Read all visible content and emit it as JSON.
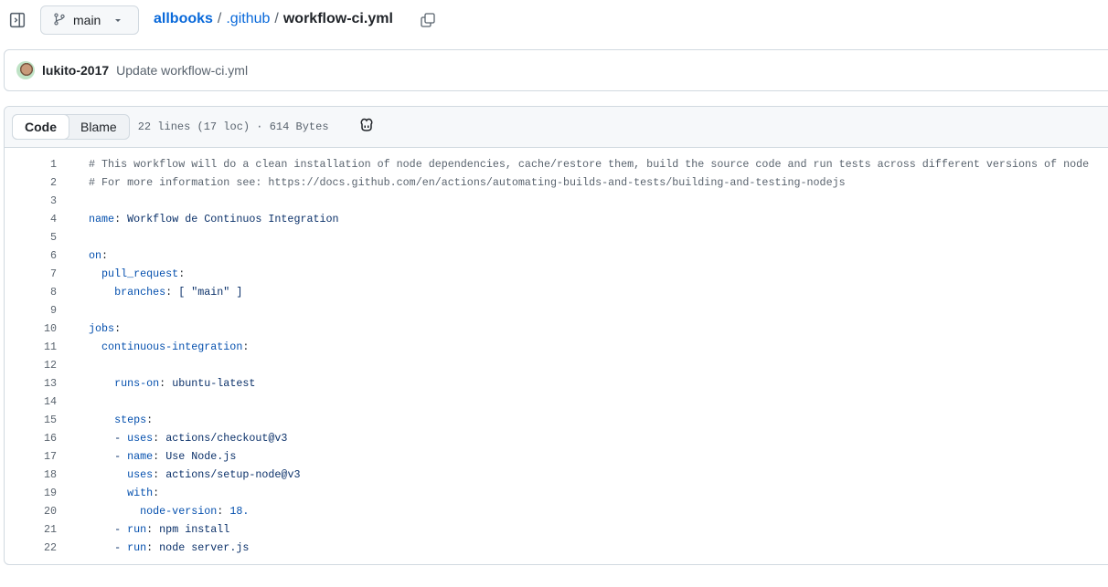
{
  "header": {
    "branch": "main",
    "repo": "allbooks",
    "folder": ".github",
    "file": "workflow-ci.yml",
    "sep": "/"
  },
  "commit": {
    "author": "lukito-2017",
    "message": "Update workflow-ci.yml"
  },
  "toolbar": {
    "code_tab": "Code",
    "blame_tab": "Blame",
    "meta": "22 lines (17 loc) · 614 Bytes"
  },
  "colors": {
    "link": "#0969da",
    "key": "#0550ae",
    "string": "#0a3069",
    "comment": "#59636e"
  },
  "lines": [
    [
      [
        "c",
        "# This workflow will do a clean installation of node dependencies, cache/restore them, build the source code and run tests across different versions of node"
      ]
    ],
    [
      [
        "c",
        "# For more information see: https://docs.github.com/en/actions/automating-builds-and-tests/building-and-testing-nodejs"
      ]
    ],
    [],
    [
      [
        "k",
        "name"
      ],
      [
        "p",
        ": "
      ],
      [
        "v",
        "Workflow de Continuos Integration"
      ]
    ],
    [],
    [
      [
        "k",
        "on"
      ],
      [
        "p",
        ":"
      ]
    ],
    [
      [
        "p",
        "  "
      ],
      [
        "k",
        "pull_request"
      ],
      [
        "p",
        ":"
      ]
    ],
    [
      [
        "p",
        "    "
      ],
      [
        "k",
        "branches"
      ],
      [
        "p",
        ": "
      ],
      [
        "v",
        "[ \"main\" ]"
      ]
    ],
    [],
    [
      [
        "k",
        "jobs"
      ],
      [
        "p",
        ":"
      ]
    ],
    [
      [
        "p",
        "  "
      ],
      [
        "k",
        "continuous-integration"
      ],
      [
        "p",
        ":"
      ]
    ],
    [],
    [
      [
        "p",
        "    "
      ],
      [
        "k",
        "runs-on"
      ],
      [
        "p",
        ": "
      ],
      [
        "v",
        "ubuntu-latest"
      ]
    ],
    [],
    [
      [
        "p",
        "    "
      ],
      [
        "k",
        "steps"
      ],
      [
        "p",
        ":"
      ]
    ],
    [
      [
        "p",
        "    "
      ],
      [
        "v",
        "- "
      ],
      [
        "k",
        "uses"
      ],
      [
        "p",
        ": "
      ],
      [
        "v",
        "actions/checkout@v3"
      ]
    ],
    [
      [
        "p",
        "    "
      ],
      [
        "v",
        "- "
      ],
      [
        "k",
        "name"
      ],
      [
        "p",
        ": "
      ],
      [
        "v",
        "Use Node.js"
      ]
    ],
    [
      [
        "p",
        "      "
      ],
      [
        "k",
        "uses"
      ],
      [
        "p",
        ": "
      ],
      [
        "v",
        "actions/setup-node@v3"
      ]
    ],
    [
      [
        "p",
        "      "
      ],
      [
        "k",
        "with"
      ],
      [
        "p",
        ":"
      ]
    ],
    [
      [
        "p",
        "        "
      ],
      [
        "k",
        "node-version"
      ],
      [
        "p",
        ": "
      ],
      [
        "n",
        "18."
      ]
    ],
    [
      [
        "p",
        "    "
      ],
      [
        "v",
        "- "
      ],
      [
        "k",
        "run"
      ],
      [
        "p",
        ": "
      ],
      [
        "v",
        "npm install"
      ]
    ],
    [
      [
        "p",
        "    "
      ],
      [
        "v",
        "- "
      ],
      [
        "k",
        "run"
      ],
      [
        "p",
        ": "
      ],
      [
        "v",
        "node server.js"
      ]
    ]
  ]
}
